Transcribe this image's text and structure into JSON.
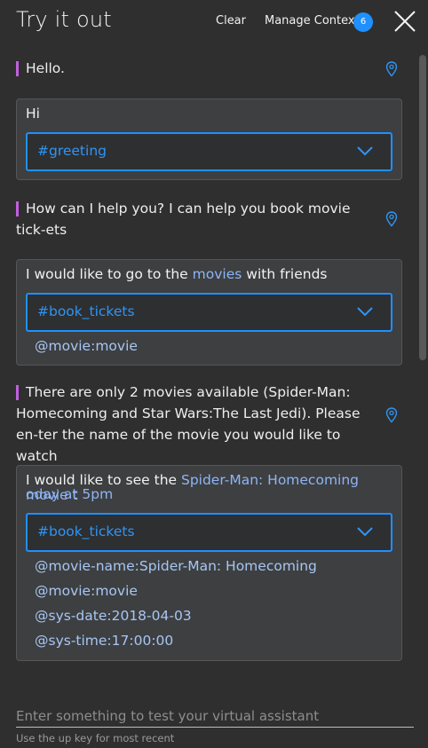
{
  "header": {
    "title": "Try it out",
    "clear_label": "Clear",
    "manage_context_label": "Manage Context",
    "context_count": "6"
  },
  "messages": {
    "bot1": "Hello.",
    "user1": {
      "text": "Hi",
      "intent": "#greeting"
    },
    "bot2": "How can I help you? I can help you book movie tick-ets",
    "user2": {
      "text_before": "I would like to go to the ",
      "text_highlight": "movies",
      "text_after": " with friends",
      "intent": "#book_tickets",
      "entities": [
        "@movie:movie"
      ]
    },
    "bot3": "There are only 2 movies available (Spider-Man: Homecoming and Star Wars:The Last Jedi). Please en-ter the name of the movie you would like to watch",
    "user3": {
      "text_before": "I would like to see the ",
      "text_highlight_line1": "Spider-Man: Homecoming movie t",
      "text_highlight_line2": "oday at 5pm",
      "intent": "#book_tickets",
      "entities": [
        "@movie-name:Spider-Man: Homecoming",
        "@movie:movie",
        "@sys-date:2018-04-03",
        "@sys-time:17:00:00"
      ]
    }
  },
  "input": {
    "placeholder": "Enter something to test your virtual assistant",
    "hint": "Use the up key for most recent"
  },
  "icons": {
    "close": "close-icon",
    "pin": "location-pin-icon",
    "chevron": "chevron-down-icon"
  },
  "colors": {
    "accent": "#1e90ff",
    "bot_bar": "#c25fe0",
    "entity": "#a8c6f2"
  }
}
